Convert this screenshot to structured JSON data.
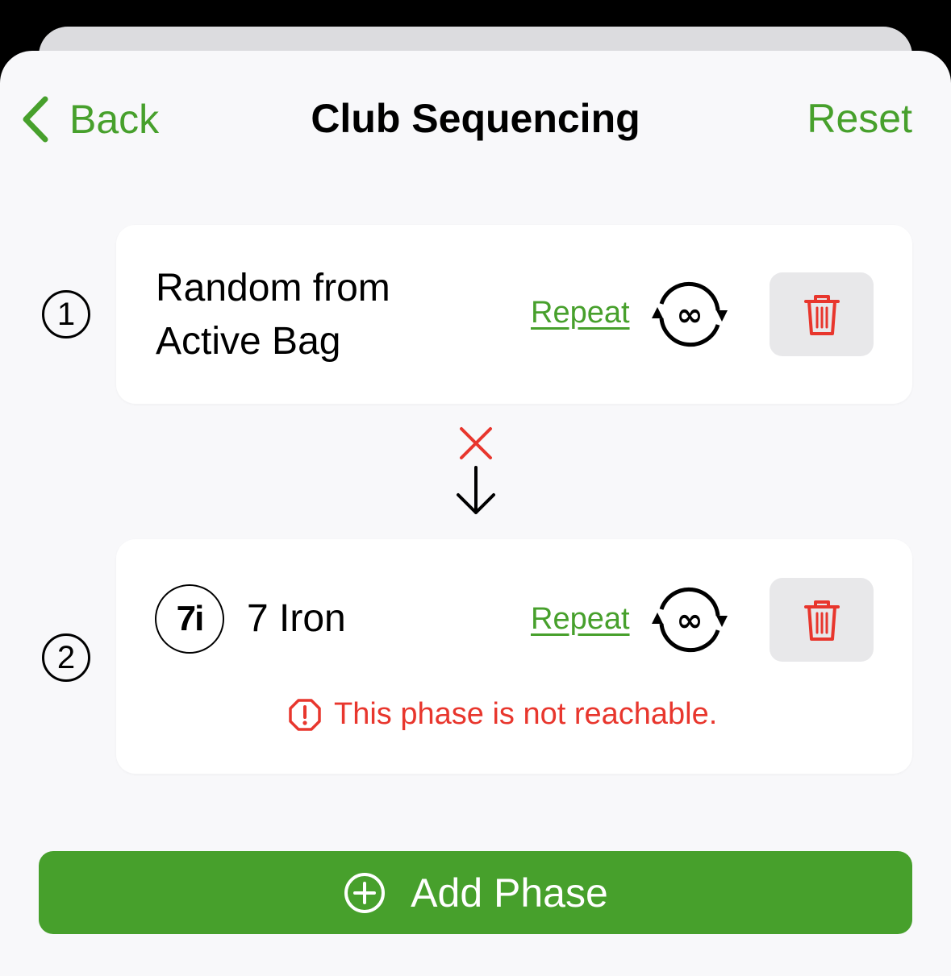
{
  "nav": {
    "back_label": "Back",
    "title": "Club Sequencing",
    "reset_label": "Reset"
  },
  "phases": [
    {
      "number": "1",
      "title_line1": "Random from",
      "title_line2": "Active Bag",
      "repeat_label": "Repeat",
      "repeat_icon": "repeat-infinite-icon",
      "delete_icon": "trash-icon"
    },
    {
      "number": "2",
      "club_badge": "7i",
      "title": "7 Iron",
      "repeat_label": "Repeat",
      "repeat_icon": "repeat-infinite-icon",
      "delete_icon": "trash-icon",
      "warning": "This phase is not reachable."
    }
  ],
  "connector": {
    "blocked_icon": "x-icon",
    "arrow_icon": "arrow-down-icon"
  },
  "add_phase": {
    "label": "Add Phase",
    "icon": "plus-circle-icon"
  },
  "colors": {
    "accent": "#47a02c",
    "danger": "#e8362d",
    "background": "#f8f8fa"
  }
}
